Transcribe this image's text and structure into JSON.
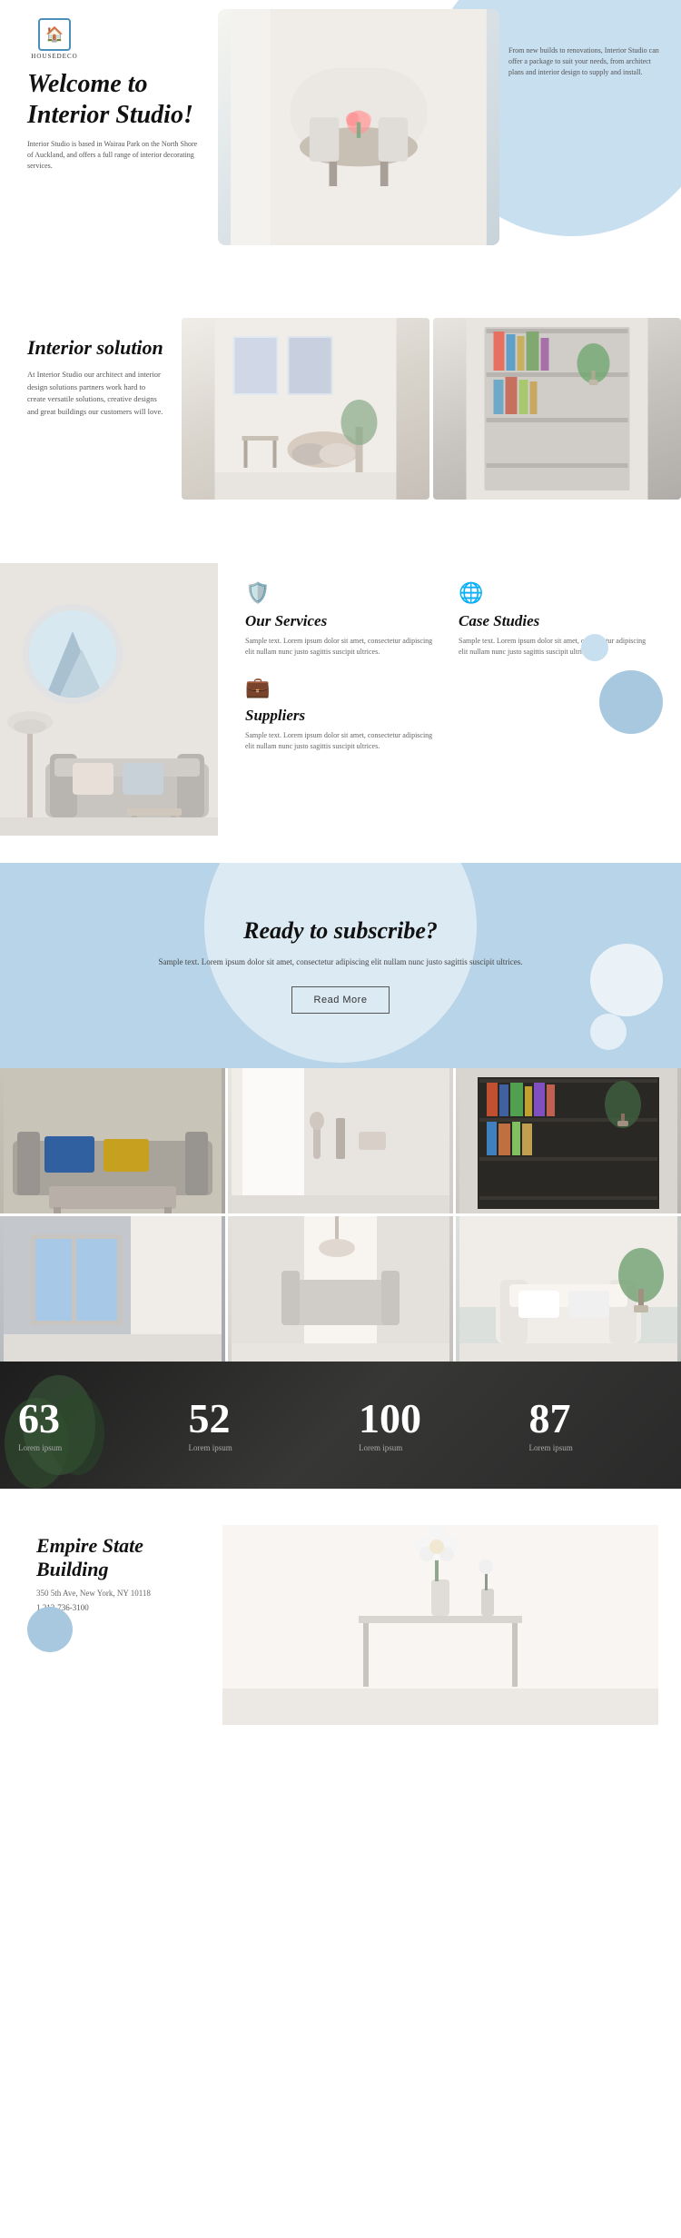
{
  "logo": {
    "icon": "🏠",
    "name": "HOUSEDECO"
  },
  "hero": {
    "title": "Welcome to\nInterior Studio!",
    "left_desc": "Interior Studio is based in Wairau Park on the North Shore of Auckland, and offers a full range of interior decorating services.",
    "right_desc": "From new builds to renovations, Interior Studio can offer a package to suit your needs, from architect plans and interior design to supply and install."
  },
  "interior_solution": {
    "title": "Interior solution",
    "desc": "At Interior Studio our architect and interior design solutions partners work hard to create versatile solutions, creative designs and great buildings our customers will love."
  },
  "services": {
    "our_services": {
      "title": "Our Services",
      "desc": "Sample text. Lorem ipsum dolor sit amet, consectetur adipiscing elit nullam nunc justo sagittis suscipit ultrices."
    },
    "case_studies": {
      "title": "Case Studies",
      "desc": "Sample text. Lorem ipsum dolor sit amet, consectetur adipiscing elit nullam nunc justo sagittis suscipit ultrices."
    },
    "suppliers": {
      "title": "Suppliers",
      "desc": "Sample text. Lorem ipsum dolor sit amet, consectetur adipiscing elit nullam nunc justo sagittis suscipit ultrices."
    }
  },
  "subscribe": {
    "title": "Ready to subscribe?",
    "desc": "Sample text. Lorem ipsum dolor sit amet, consectetur adipiscing elit nullam nunc justo sagittis suscipit ultrices.",
    "button_label": "Read More"
  },
  "stats": [
    {
      "number": "63",
      "label": "Lorem ipsum"
    },
    {
      "number": "52",
      "label": "Lorem ipsum"
    },
    {
      "number": "100",
      "label": "Lorem ipsum"
    },
    {
      "number": "87",
      "label": "Lorem ipsum"
    }
  ],
  "contact": {
    "title": "Empire State Building",
    "address": "350 5th Ave, New York, NY 10118",
    "phone": "1 212-736-3100"
  },
  "icons": {
    "shield": "🛡",
    "globe": "🌐",
    "briefcase": "💼",
    "house": "🏠"
  }
}
